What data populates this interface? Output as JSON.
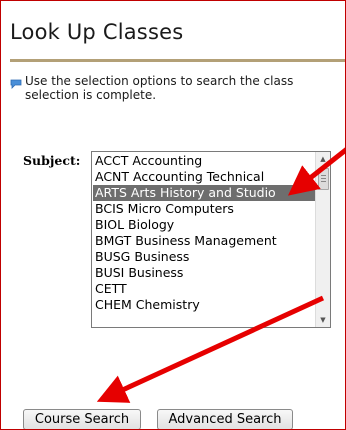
{
  "page": {
    "title": "Look Up Classes",
    "info_text_line1": "Use the selection options to search the class",
    "info_text_line2": "selection is complete."
  },
  "form": {
    "subject_label": "Subject:",
    "subject_options": [
      "ACCT Accounting",
      "ACNT Accounting Technical",
      "ARTS Arts History and Studio",
      "BCIS Micro Computers",
      "BIOL Biology",
      "BMGT Business Management",
      "BUSG Business",
      "BUSI Business",
      "CETT",
      "CHEM Chemistry"
    ],
    "selected_option": "ARTS Arts History and Studio",
    "course_search_label": "Course Search",
    "advanced_search_label": "Advanced Search"
  },
  "annotations": {
    "arrow_color": "#e60000",
    "accent_rule_color": "#b3a077",
    "selected_bg_color": "#6e6e6e"
  },
  "icons": {
    "info": "info-icon",
    "scroll_up": "scroll-up-icon",
    "scroll_down": "scroll-down-icon"
  }
}
